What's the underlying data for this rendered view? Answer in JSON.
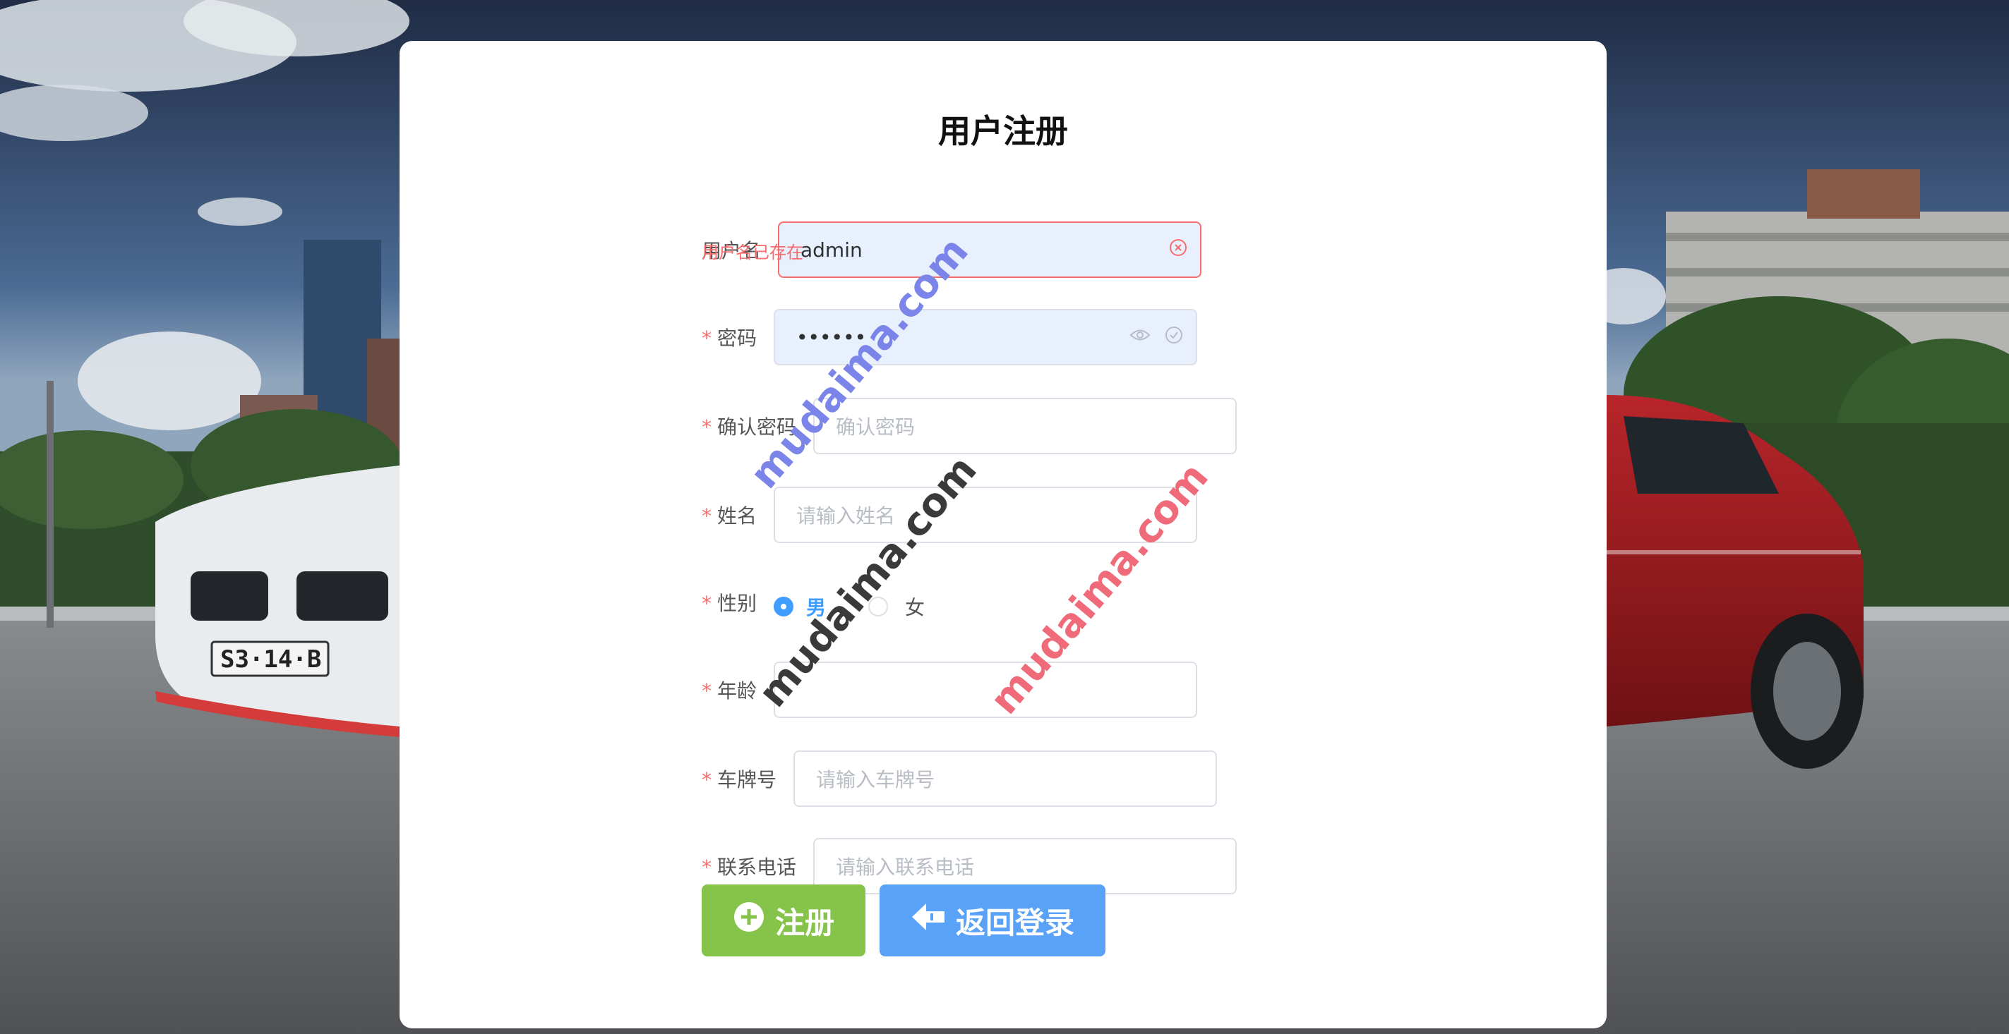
{
  "page": {
    "title": "用户注册"
  },
  "form": {
    "username": {
      "label": "用户名",
      "value": "admin",
      "error": "用户名已存在"
    },
    "password": {
      "star": "*",
      "label": "密码",
      "value": "••••••"
    },
    "confirm_password": {
      "star": "*",
      "label": "确认密码",
      "placeholder": "确认密码"
    },
    "name": {
      "star": "*",
      "label": "姓名",
      "placeholder": "请输入姓名"
    },
    "gender": {
      "star": "*",
      "label": "性别",
      "options": [
        "男",
        "女"
      ],
      "selected": "男"
    },
    "age": {
      "star": "*",
      "label": "年龄",
      "placeholder": ""
    },
    "plate": {
      "star": "*",
      "label": "车牌号",
      "placeholder": "请输入车牌号"
    },
    "phone": {
      "star": "*",
      "label": "联系电话",
      "placeholder": "请输入联系电话"
    }
  },
  "buttons": {
    "register": "注册",
    "back_login": "返回登录"
  },
  "watermarks": [
    "mudaima.com",
    "mudaima.com",
    "mudaima.com"
  ],
  "colors": {
    "accent": "#409eff",
    "error": "#f56c6c",
    "register_btn": "#85c34a",
    "back_btn": "#5aa2f7"
  },
  "icons": {
    "clear": "circle-close-icon",
    "eye": "eye-icon",
    "check": "circle-check-icon",
    "register": "circle-plus-icon",
    "back": "back-arrow-icon"
  }
}
